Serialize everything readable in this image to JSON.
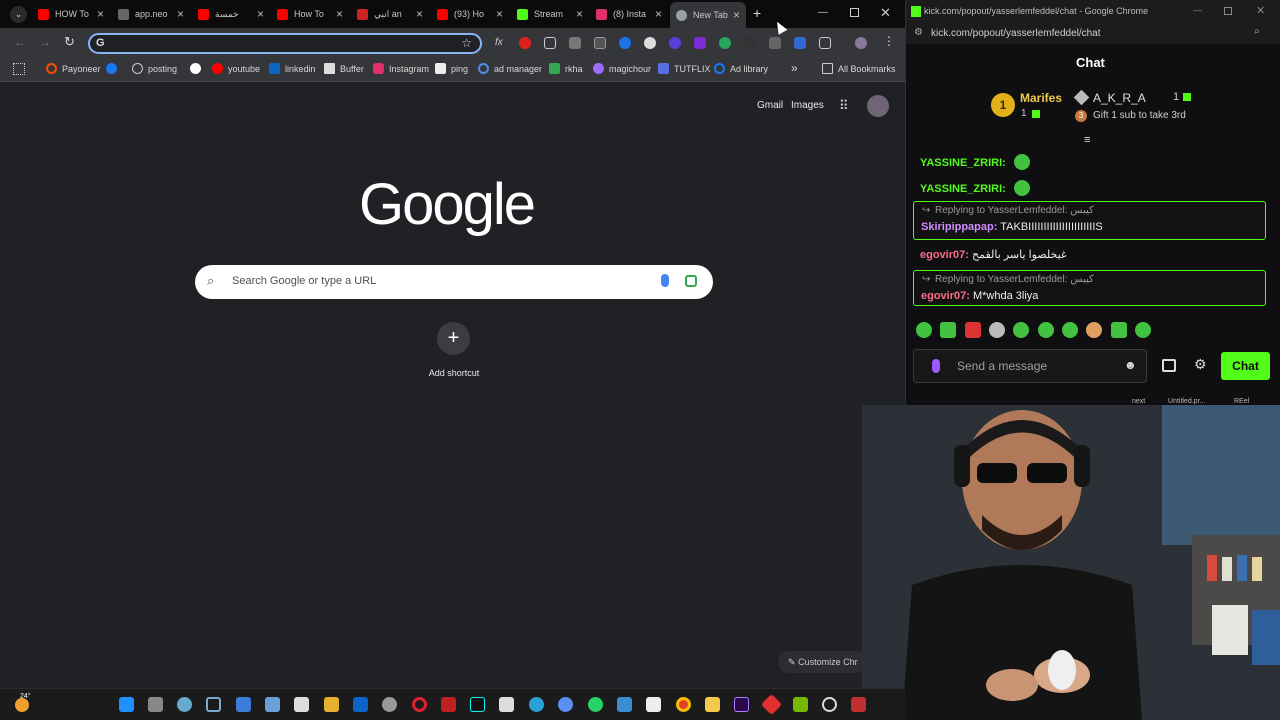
{
  "browser": {
    "tabs": [
      {
        "title": "HOW To",
        "color": "#ff0000",
        "active": false
      },
      {
        "title": "app.neo",
        "color": "#888888",
        "active": false
      },
      {
        "title": "خمسة",
        "color": "#ff0000",
        "active": false
      },
      {
        "title": "How To",
        "color": "#ff0000",
        "active": false
      },
      {
        "title": "انبي an",
        "color": "#cc2222",
        "active": false
      },
      {
        "title": "(93) Ho",
        "color": "#ff0000",
        "active": false
      },
      {
        "title": "Stream",
        "color": "#53fc18",
        "active": false
      },
      {
        "title": "(8) Insta",
        "color": "#e1306c",
        "active": false
      },
      {
        "title": "New Tab",
        "color": "#9aa0a6",
        "active": true
      }
    ],
    "new_tab_symbol": "+",
    "omnibox_value": "",
    "bookmarks": [
      "Payoneer",
      "posting",
      "youtube",
      "linkedin",
      "Buffer",
      "Instagram",
      "ping",
      "ad manager",
      "rkha",
      "magichour",
      "TUTFLIX",
      "Ad library"
    ],
    "bookmarks_more": "»",
    "all_bookmarks": "All Bookmarks"
  },
  "newtab": {
    "links": {
      "gmail": "Gmail",
      "images": "Images"
    },
    "logo_text": "Google",
    "search_placeholder": "Search Google or type a URL",
    "add_shortcut_label": "Add shortcut",
    "customize_label": "Customize Chr"
  },
  "chat_window": {
    "title_bar": "kick.com/popout/yasserlemfeddel/chat - Google Chrome",
    "url": "kick.com/popout/yasserlemfeddel/chat",
    "header": "Chat",
    "leaderboard": {
      "first_rank": "1",
      "first_name": "Marifes",
      "first_count": "1",
      "second_name": "A_K_R_A",
      "second_count": "1",
      "third_rank": "3",
      "third_prompt": "Gift 1 sub to take 3rd"
    },
    "messages": [
      {
        "user": "YASSINE_ZRIRI:",
        "text": ""
      },
      {
        "user": "YASSINE_ZRIRI:",
        "text": ""
      }
    ],
    "reply1": {
      "replying": "Replying to YasserLemfeddel: كيبس",
      "user": "Skiripippapap:",
      "text": "TAKBIIIIIIIIIIIIIIIIIIIIIIS"
    },
    "msg3": {
      "user": "egovir07:",
      "text": "غيخلصوا ياسر بالقمح"
    },
    "reply2": {
      "replying": "Replying to YasserLemfeddel: كيبس",
      "user": "egovir07:",
      "text": "M*whda 3liya"
    },
    "input_placeholder": "Send a message",
    "send_button": "Chat"
  },
  "overlay_labels": {
    "next": "next",
    "untitled": "Untitled.pr...",
    "reel": "REel"
  },
  "weather": "24°",
  "colors": {
    "kick_green": "#53fc18",
    "chrome_blue": "#8ab4f8"
  }
}
